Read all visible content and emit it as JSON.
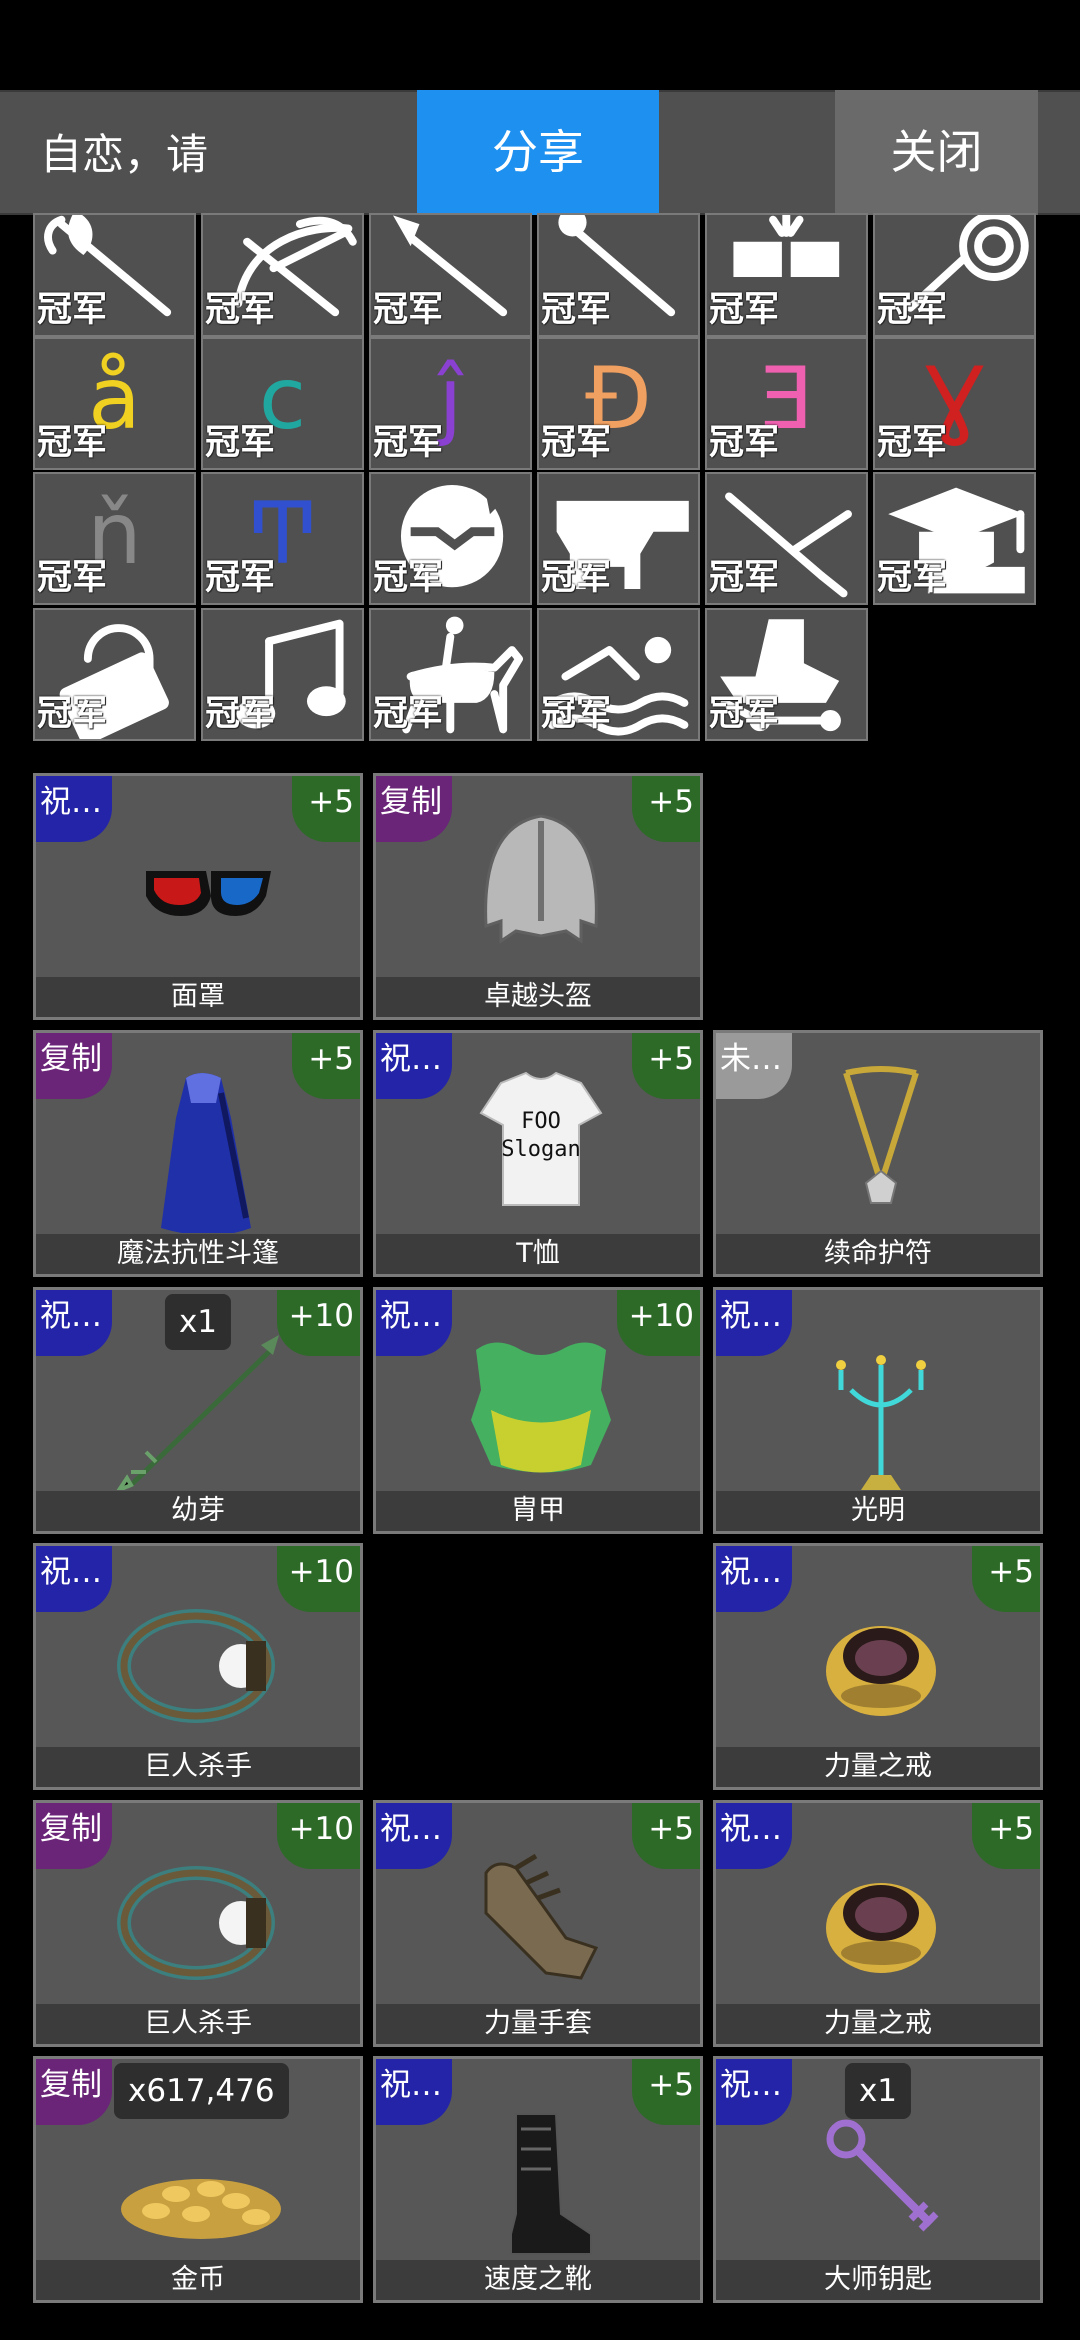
{
  "header": {
    "label": "自恋，请",
    "share_label": "分享",
    "close_label": "关闭"
  },
  "badge_text": "冠军",
  "glyph_badges": [
    {
      "glyph": "å",
      "color": "#f0d020"
    },
    {
      "glyph": "ϲ",
      "color": "#20a8a0"
    },
    {
      "glyph": "ĵ",
      "color": "#8a40d0"
    },
    {
      "glyph": "Đ",
      "color": "#f0a060"
    },
    {
      "glyph": "Ǝ",
      "color": "#f060b0"
    },
    {
      "glyph": "Ɣ",
      "color": "#d02020"
    },
    {
      "glyph": "ň",
      "color": "#888888"
    },
    {
      "glyph": "Ͳ",
      "color": "#3050d0"
    }
  ],
  "icon_badges": [
    "halberd-icon",
    "crossbow-icon",
    "spear-icon",
    "staff-icon",
    "fist-bump-icon",
    "whip-icon",
    "handshake-icon",
    "anvil-icon",
    "swords-icon",
    "graduation-icon",
    "lock-icon",
    "music-note-icon",
    "horse-rider-icon",
    "swimmer-icon",
    "throne-icon"
  ],
  "items": [
    {
      "tag": "祝…",
      "tag_color": "blue",
      "plus": "+5",
      "name": "面罩",
      "art": "glasses"
    },
    {
      "tag": "复制",
      "tag_color": "purple",
      "plus": "+5",
      "name": "卓越头盔",
      "art": "helmet"
    },
    {
      "tag": "复制",
      "tag_color": "purple",
      "plus": "+5",
      "name": "魔法抗性斗篷",
      "art": "cloak"
    },
    {
      "tag": "祝…",
      "tag_color": "blue",
      "plus": "+5",
      "name": "T恤",
      "art": "tshirt",
      "tshirt_text": [
        "FOO",
        "Slogan"
      ]
    },
    {
      "tag": "未…",
      "tag_color": "gray",
      "name": "续命护符",
      "art": "amulet"
    },
    {
      "tag": "祝…",
      "tag_color": "blue",
      "qty": "x1",
      "plus": "+10",
      "name": "幼芽",
      "art": "arrow"
    },
    {
      "tag": "祝…",
      "tag_color": "blue",
      "plus": "+10",
      "name": "胄甲",
      "art": "armor"
    },
    {
      "tag": "祝…",
      "tag_color": "blue",
      "name": "光明",
      "art": "candelabra"
    },
    {
      "tag": "祝…",
      "tag_color": "blue",
      "plus": "+10",
      "name": "巨人杀手",
      "art": "necklace"
    },
    {
      "tag": "祝…",
      "tag_color": "blue",
      "plus": "+5",
      "name": "力量之戒",
      "art": "ring"
    },
    {
      "tag": "复制",
      "tag_color": "purple",
      "plus": "+10",
      "name": "巨人杀手",
      "art": "necklace"
    },
    {
      "tag": "祝…",
      "tag_color": "blue",
      "plus": "+5",
      "name": "力量手套",
      "art": "gloves"
    },
    {
      "tag": "祝…",
      "tag_color": "blue",
      "plus": "+5",
      "name": "力量之戒",
      "art": "ring"
    },
    {
      "tag": "复制",
      "tag_color": "purple",
      "qty": "x617,476",
      "name": "金币",
      "art": "coins"
    },
    {
      "tag": "祝…",
      "tag_color": "blue",
      "plus": "+5",
      "name": "速度之靴",
      "art": "boot"
    },
    {
      "tag": "祝…",
      "tag_color": "blue",
      "qty": "x1",
      "name": "大师钥匙",
      "art": "key"
    }
  ],
  "colors": {
    "share": "#1e90f0",
    "tile": "#505050",
    "tag_blue": "#2424a8",
    "tag_purple": "#6a2478",
    "plus_green": "#2d6a28"
  }
}
